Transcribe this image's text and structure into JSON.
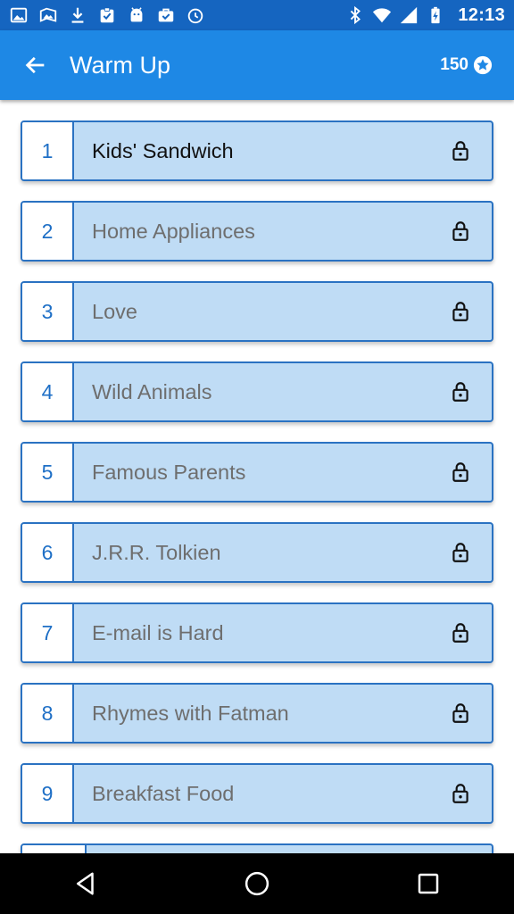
{
  "status_bar": {
    "time": "12:13",
    "left_icons": [
      "gallery-icon",
      "photos-icon",
      "download-icon",
      "clipboard-check-icon",
      "android-icon",
      "briefcase-check-icon",
      "alarm-clock-icon"
    ],
    "right_icons": [
      "bluetooth-icon",
      "wifi-icon",
      "cell-signal-icon",
      "battery-charging-icon"
    ]
  },
  "app_bar": {
    "title": "Warm Up",
    "coins": "150",
    "back_icon": "back-arrow-icon",
    "coin_icon": "star-coin-icon"
  },
  "levels": [
    {
      "number": "1",
      "title": "Kids' Sandwich"
    },
    {
      "number": "2",
      "title": "Home Appliances"
    },
    {
      "number": "3",
      "title": "Love"
    },
    {
      "number": "4",
      "title": "Wild Animals"
    },
    {
      "number": "5",
      "title": "Famous Parents"
    },
    {
      "number": "6",
      "title": "J.R.R. Tolkien"
    },
    {
      "number": "7",
      "title": "E-mail is Hard"
    },
    {
      "number": "8",
      "title": "Rhymes with Fatman"
    },
    {
      "number": "9",
      "title": "Breakfast Food"
    }
  ],
  "nav_bar": {
    "icons": [
      "back-triangle-icon",
      "home-circle-icon",
      "recents-square-icon"
    ]
  },
  "colors": {
    "status_bar": "#1565c0",
    "app_bar": "#1e88e5",
    "level_fill": "#bfdcf5",
    "level_border": "#2a72c2",
    "level_number": "#1e6fc6"
  }
}
